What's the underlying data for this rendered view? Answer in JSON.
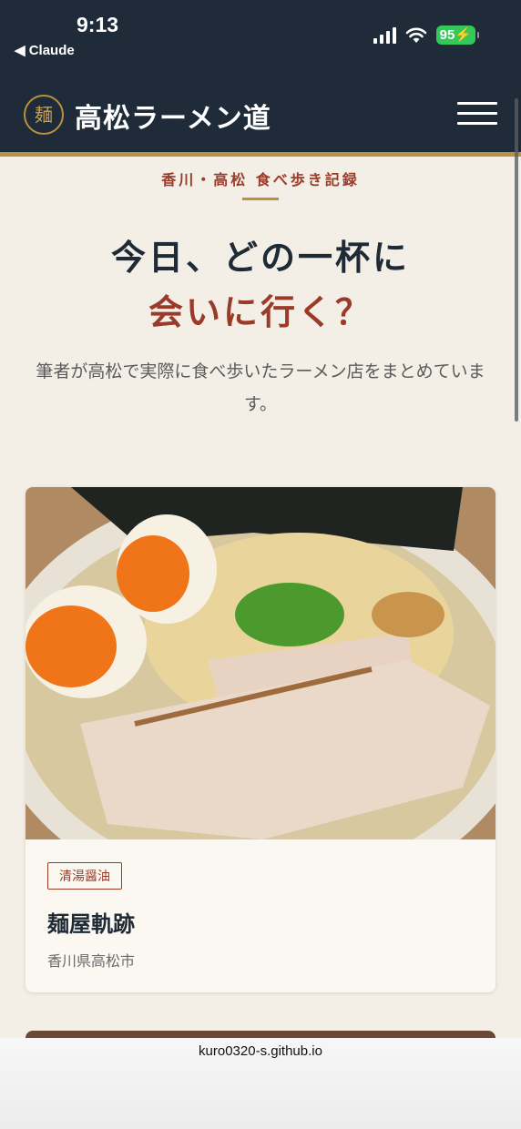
{
  "status_bar": {
    "time": "9:13",
    "back_app": "◀ Claude",
    "battery": "95",
    "battery_color": "#34c759"
  },
  "header": {
    "logo_char": "麺",
    "site_title": "高松ラーメン道",
    "menu_icon": "hamburger-icon"
  },
  "hero": {
    "eyebrow": "香川・高松 食べ歩き記録",
    "headline_line1": "今日、どの一杯に",
    "headline_line2": "会いに行く？",
    "lead": "筆者が高松で実際に食べ歩いたラーメン店をまとめています。"
  },
  "cards": [
    {
      "image": "ramen-photo",
      "tag": "清湯醤油",
      "name": "麺屋軌跡",
      "location": "香川県高松市"
    }
  ],
  "browser": {
    "url": "kuro0320-s.github.io"
  },
  "colors": {
    "navy": "#1f2b38",
    "accent_red": "#9a3b2a",
    "gold": "#b8923e",
    "background": "#f4efe6"
  }
}
